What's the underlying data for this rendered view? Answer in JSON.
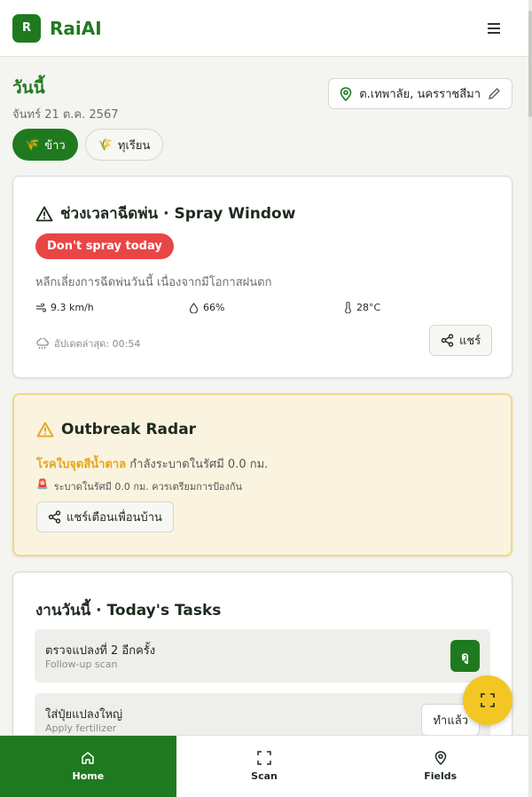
{
  "app": {
    "logo_letter": "R",
    "name": "RaiAI",
    "accent": "#1f7a1f"
  },
  "header": {
    "menu_icon": "hamburger-menu-icon"
  },
  "date": {
    "today_label": "วันนี้",
    "date_text": "จันทร์ 21 ต.ค. 2567"
  },
  "location": {
    "text": "ต.เทพาลัย, นครราชสีมา"
  },
  "crops": [
    {
      "label": "ข้าว",
      "emoji": "🌾",
      "selected": true
    },
    {
      "label": "ทุเรียน",
      "emoji": "🌾",
      "selected": false
    }
  ],
  "spray": {
    "title": "ช่วงเวลาฉีดพ่น · Spray Window",
    "status": "Don't spray today",
    "status_color": "#e84545",
    "advice": "หลีกเลี่ยงการฉีดพ่นวันนี้ เนื่องจากมีโอกาสฝนตก",
    "wind": "9.3 km/h",
    "humidity": "66%",
    "temperature": "28°C",
    "updated": "อัปเดตล่าสุด: 00:54",
    "share_label": "แชร์"
  },
  "outbreak": {
    "title": "Outbreak Radar",
    "disease": "โรคใบจุดสีน้ำตาล",
    "status_text": "กำลังระบาดในรัศมี 0.0 กม.",
    "alert_emoji": "🚨",
    "alert_text": "ระบาดในรัศมี 0.0 กม. ควรเตรียมการป้องกัน",
    "share_label": "แชร์เตือนเพื่อนบ้าน",
    "warning_color": "#e8a317"
  },
  "tasks": {
    "title": "งานวันนี้ · Today's Tasks",
    "items": [
      {
        "title": "ตรวจแปลงที่ 2 อีกครั้ง",
        "subtitle": "Follow-up scan",
        "action": "ดู"
      },
      {
        "title": "ใส่ปุ๋ยแปลงใหญ่",
        "subtitle": "Apply fertilizer",
        "action": "ทำแล้ว"
      }
    ]
  },
  "fab": {
    "icon": "scan-frame-icon"
  },
  "nav": [
    {
      "label": "Home",
      "icon": "home-icon",
      "active": true
    },
    {
      "label": "Scan",
      "icon": "scan-icon",
      "active": false
    },
    {
      "label": "Fields",
      "icon": "map-pin-icon",
      "active": false
    }
  ]
}
